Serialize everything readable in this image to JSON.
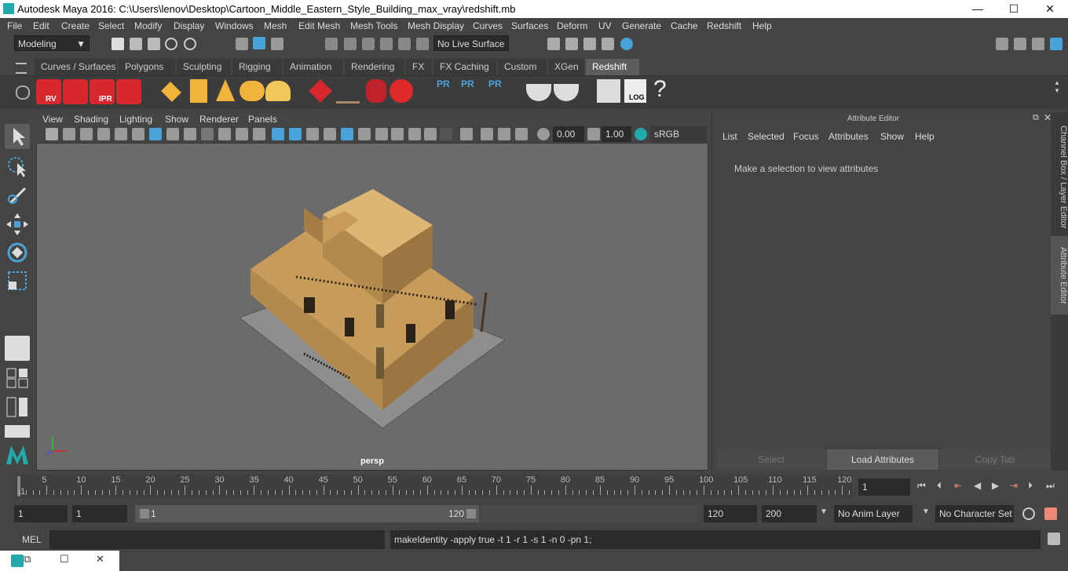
{
  "window": {
    "title": "Autodesk Maya 2016: C:\\Users\\lenov\\Desktop\\Cartoon_Middle_Eastern_Style_Building_max_vray\\redshift.mb",
    "minimize": "—",
    "maximize": "☐",
    "close": "✕"
  },
  "menu": [
    "File",
    "Edit",
    "Create",
    "Select",
    "Modify",
    "Display",
    "Windows",
    "Mesh",
    "Edit Mesh",
    "Mesh Tools",
    "Mesh Display",
    "Curves",
    "Surfaces",
    "Deform",
    "UV",
    "Generate",
    "Cache",
    "Redshift",
    "Help"
  ],
  "statusline": {
    "mode": "Modeling",
    "live_surface": "No Live Surface"
  },
  "shelf_tabs": [
    "Curves / Surfaces",
    "Polygons",
    "Sculpting",
    "Rigging",
    "Animation",
    "Rendering",
    "FX",
    "FX Caching",
    "Custom",
    "XGen",
    "Redshift"
  ],
  "shelf_active": "Redshift",
  "shelf_icons": {
    "rv": "RV",
    "ipr": "IPR",
    "pr1": "PR",
    "pr2": "PR",
    "pr3": "PR",
    "log": "LOG",
    "help": "?"
  },
  "panel_menu": [
    "View",
    "Shading",
    "Lighting",
    "Show",
    "Renderer",
    "Panels"
  ],
  "panel_toolbar": {
    "exposure": "0.00",
    "gamma": "1.00",
    "color_mgmt": "sRGB gamma"
  },
  "viewport": {
    "camera": "persp",
    "background": "#6b6b6b"
  },
  "attribute_editor": {
    "header": "Attribute Editor",
    "menu": [
      "List",
      "Selected",
      "Focus",
      "Attributes",
      "Show",
      "Help"
    ],
    "message": "Make a selection to view attributes",
    "buttons": [
      "Select",
      "Load Attributes",
      "Copy Tab"
    ]
  },
  "side_tabs": [
    "Channel Box / Layer Editor",
    "Attribute Editor"
  ],
  "time_slider": {
    "ticks": [
      1,
      5,
      10,
      15,
      20,
      25,
      30,
      35,
      40,
      45,
      50,
      55,
      60,
      65,
      70,
      75,
      80,
      85,
      90,
      95,
      100,
      105,
      110,
      115,
      120
    ],
    "current_frame": "1",
    "current_label": "1"
  },
  "range_slider": {
    "start": "1",
    "playback_start": "1",
    "range_min": "1",
    "range_max": "120",
    "playback_end": "120",
    "end": "200",
    "anim_layer": "No Anim Layer",
    "character_set": "No Character Set"
  },
  "command_line": {
    "label": "MEL",
    "input": "",
    "result": "makeIdentity -apply true -t 1 -r 1 -s 1 -n 0 -pn 1;"
  },
  "colors": {
    "accent": "#5d5d5d",
    "redshift_red": "#d9272e",
    "highlight_blue": "#4aa3d8"
  }
}
